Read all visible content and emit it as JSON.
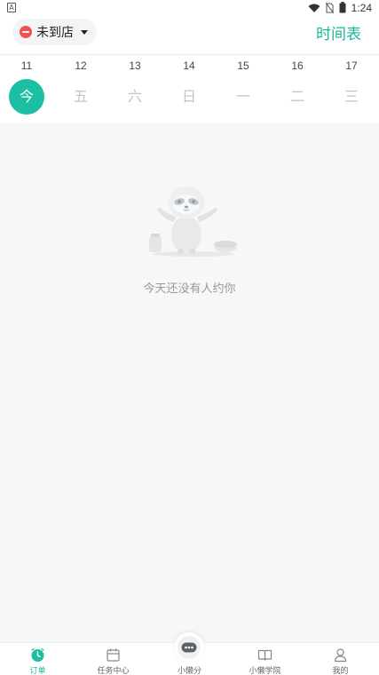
{
  "status_bar": {
    "left_icon": "notification-a-icon",
    "time": "1:24",
    "icons": [
      "wifi-icon",
      "no-sim-icon",
      "battery-icon"
    ]
  },
  "header": {
    "store_status": "未到店",
    "store_status_icon": "minus-circle-icon",
    "dropdown_icon": "caret-down-icon",
    "schedule_label": "时间表"
  },
  "date_strip": {
    "days": [
      {
        "num": "11",
        "name": "今",
        "active": true
      },
      {
        "num": "12",
        "name": "五",
        "active": false
      },
      {
        "num": "13",
        "name": "六",
        "active": false
      },
      {
        "num": "14",
        "name": "日",
        "active": false
      },
      {
        "num": "15",
        "name": "一",
        "active": false
      },
      {
        "num": "16",
        "name": "二",
        "active": false
      },
      {
        "num": "17",
        "name": "三",
        "active": false
      }
    ]
  },
  "empty_state": {
    "illustration": "sloth-mascot-illustration",
    "message": "今天还没有人约你"
  },
  "tab_bar": {
    "items": [
      {
        "label": "订单",
        "icon": "clock-icon",
        "active": true
      },
      {
        "label": "任务中心",
        "icon": "calendar-icon",
        "active": false
      },
      {
        "label": "小懒分",
        "icon": "chat-bubble-icon",
        "active": false
      },
      {
        "label": "小懒学院",
        "icon": "book-icon",
        "active": false
      },
      {
        "label": "我的",
        "icon": "user-icon",
        "active": false
      }
    ]
  },
  "colors": {
    "accent": "#1cbfa3",
    "accent_text": "#19b69c",
    "status_red": "#f05252",
    "content_bg": "#f6f7f9"
  }
}
